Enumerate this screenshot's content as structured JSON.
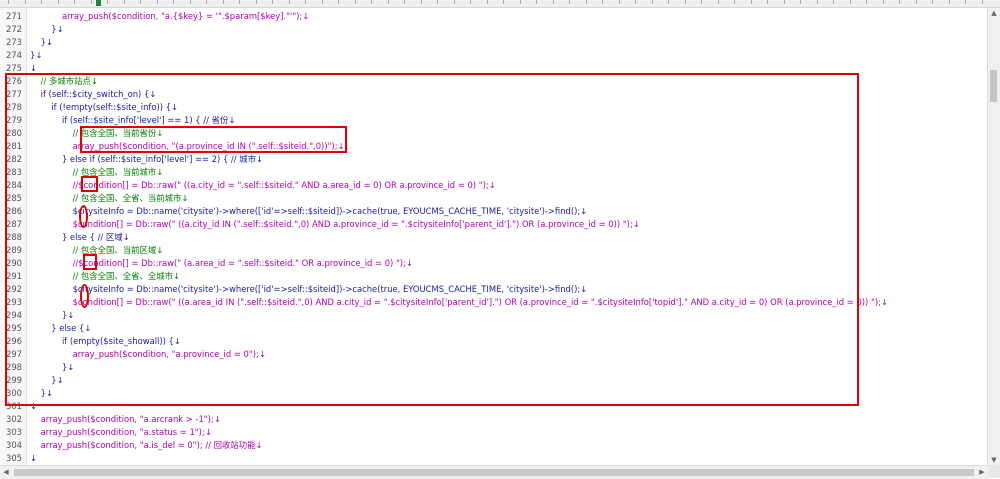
{
  "editor": {
    "lines": [
      {
        "n": "271",
        "t": "            array_push($condition, \"a.{$key} = '\".$param[$key].\"'\");↓",
        "c": "str"
      },
      {
        "n": "272",
        "t": "        }↓",
        "c": "kw"
      },
      {
        "n": "273",
        "t": "    }↓",
        "c": "kw"
      },
      {
        "n": "274",
        "t": "}↓",
        "c": "kw"
      },
      {
        "n": "275",
        "t": "↓",
        "c": "kw"
      },
      {
        "n": "276",
        "t": "    // 多城市站点↓",
        "c": "cmt"
      },
      {
        "n": "277",
        "t": "    if (self::$city_switch_on) {↓",
        "c": "kw"
      },
      {
        "n": "278",
        "t": "        if (!empty(self::$site_info)) {↓",
        "c": "kw"
      },
      {
        "n": "279",
        "t": "            if (self::$site_info['level'] == 1) { // 省份↓",
        "c": "kw"
      },
      {
        "n": "280",
        "t": "                // 包含全国、当前省份↓",
        "c": "cmt"
      },
      {
        "n": "281",
        "t": "                array_push($condition, \"(a.province_id IN (\".self::$siteid.\",0))\");↓",
        "c": "str"
      },
      {
        "n": "282",
        "t": "            } else if (self::$site_info['level'] == 2) { // 城市↓",
        "c": "kw"
      },
      {
        "n": "283",
        "t": "                // 包含全国、当前城市↓",
        "c": "cmt"
      },
      {
        "n": "284",
        "t": "                //$condition[] = Db::raw(\" ((a.city_id = \".self::$siteid.\" AND a.area_id = 0) OR a.province_id = 0) \");↓",
        "c": "str"
      },
      {
        "n": "285",
        "t": "                // 包含全国、全省、当前城市↓",
        "c": "cmt"
      },
      {
        "n": "286",
        "t": "                $citysiteInfo = Db::name('citysite')->where(['id'=>self::$siteid])->cache(true, EYOUCMS_CACHE_TIME, 'citysite')->find();↓",
        "c": "kw"
      },
      {
        "n": "287",
        "t": "                $condition[] = Db::raw(\" ((a.city_id IN (\".self::$siteid.\",0) AND a.province_id = \".$citysiteInfo['parent_id'].\") OR (a.province_id = 0)) \");↓",
        "c": "str"
      },
      {
        "n": "288",
        "t": "            } else { // 区域↓",
        "c": "kw"
      },
      {
        "n": "289",
        "t": "                // 包含全国、当前区域↓",
        "c": "cmt"
      },
      {
        "n": "290",
        "t": "                //$condition[] = Db::raw(\" (a.area_id = \".self::$siteid.\" OR a.province_id = 0) \");↓",
        "c": "str"
      },
      {
        "n": "291",
        "t": "                // 包含全国、全省、全城市↓",
        "c": "cmt"
      },
      {
        "n": "292",
        "t": "                $citysiteInfo = Db::name('citysite')->where(['id'=>self::$siteid])->cache(true, EYOUCMS_CACHE_TIME, 'citysite')->find();↓",
        "c": "kw"
      },
      {
        "n": "293",
        "t": "                $condition[] = Db::raw(\" ((a.area_id IN (\".self::$siteid.\",0) AND a.city_id = \".$citysiteInfo['parent_id'].\") OR (a.province_id = \".$citysiteInfo['topid'].\" AND a.city_id = 0) OR (a.province_id = 0)) \");↓",
        "c": "str"
      },
      {
        "n": "294",
        "t": "            }↓",
        "c": "kw"
      },
      {
        "n": "295",
        "t": "        } else {↓",
        "c": "kw"
      },
      {
        "n": "296",
        "t": "            if (empty($site_showall)) {↓",
        "c": "kw"
      },
      {
        "n": "297",
        "t": "                array_push($condition, \"a.province_id = 0\");↓",
        "c": "str"
      },
      {
        "n": "298",
        "t": "            }↓",
        "c": "kw"
      },
      {
        "n": "299",
        "t": "        }↓",
        "c": "kw"
      },
      {
        "n": "300",
        "t": "    }↓",
        "c": "kw"
      },
      {
        "n": "301",
        "t": "↓",
        "c": "kw"
      },
      {
        "n": "302",
        "t": "    array_push($condition, \"a.arcrank > -1\");↓",
        "c": "str"
      },
      {
        "n": "303",
        "t": "    array_push($condition, \"a.status = 1\");↓",
        "c": "str"
      },
      {
        "n": "304",
        "t": "    array_push($condition, \"a.is_del = 0\"); // 回收站功能↓",
        "c": "str"
      },
      {
        "n": "305",
        "t": "↓",
        "c": "kw"
      }
    ]
  },
  "colors": {
    "annotation": "#e00000",
    "keyword": "#1a1aa6",
    "string": "#b000b0",
    "comment": "#008000"
  }
}
